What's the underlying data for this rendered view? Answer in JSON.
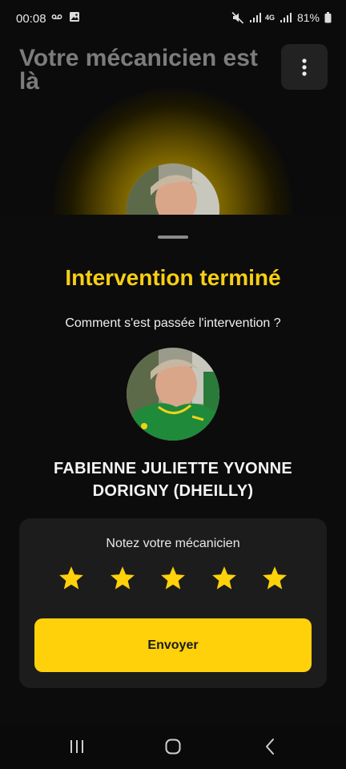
{
  "status_bar": {
    "time": "00:08",
    "battery": "81%",
    "network_label": "4G",
    "icons": [
      "voicemail-icon",
      "image-icon",
      "mute-icon",
      "signal-icon",
      "battery-icon"
    ]
  },
  "header": {
    "title": "Votre mécanicien est là",
    "menu_icon": "more-vertical-icon"
  },
  "sheet": {
    "title": "Intervention terminé",
    "subtitle": "Comment s'est passée l'intervention ?",
    "mechanic_name": "FABIENNE JULIETTE YVONNE DORIGNY (DHEILLY)",
    "rating": {
      "label": "Notez votre mécanicien",
      "value": 5,
      "max": 5
    },
    "send_label": "Envoyer"
  },
  "colors": {
    "accent": "#ffd10a",
    "title_accent": "#f8cf12",
    "background": "#0b0b0b",
    "card": "#1c1c1c"
  },
  "nav": {
    "items": [
      "recent-apps-icon",
      "home-icon",
      "back-icon"
    ]
  }
}
